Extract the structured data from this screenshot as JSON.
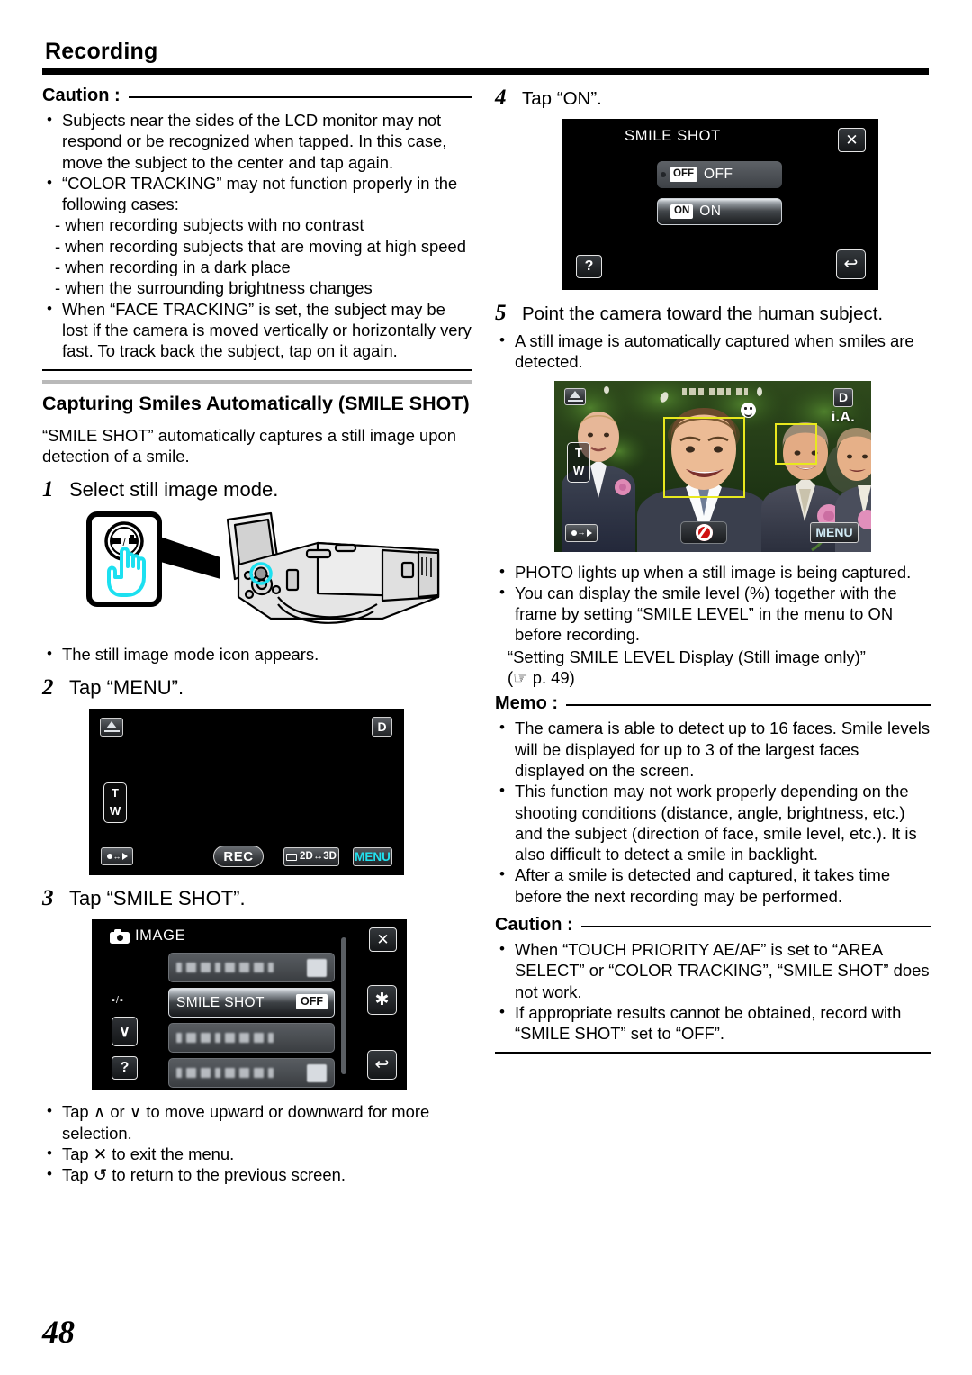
{
  "header": {
    "title": "Recording"
  },
  "page_number": "48",
  "left": {
    "caution1": {
      "label": "Caution :",
      "bullets": [
        "Subjects near the sides of the LCD monitor may not respond or be recognized when tapped. In this case, move the subject to the center and tap again.",
        "“COLOR TRACKING” may not function properly in the following cases:",
        "When “FACE TRACKING” is set, the subject may be lost if the camera is moved vertically or horizontally very fast. To track back the subject, tap on it again."
      ],
      "sublines": [
        "- when recording subjects with no contrast",
        "- when recording subjects that are moving at high speed",
        "- when recording in a dark place",
        "- when the surrounding brightness changes"
      ]
    },
    "section": {
      "heading": "Capturing Smiles Automatically (SMILE SHOT)",
      "intro": "“SMILE SHOT” automatically captures a still image upon detection of a smile."
    },
    "step1": {
      "num": "1",
      "text": "Select still image mode.",
      "note": "The still image mode icon appears."
    },
    "step2": {
      "num": "2",
      "text": "Tap “MENU”."
    },
    "step3": {
      "num": "3",
      "text": "Tap “SMILE SHOT”.",
      "notes": [
        "Tap ∧ or ∨ to move upward or downward for more selection.",
        "Tap ✕ to exit the menu.",
        "Tap ↺ to return to the previous screen."
      ]
    },
    "lcd_rec": {
      "warning_icon": "triangle-warning-icon",
      "d_badge": "D",
      "zoom_t": "T",
      "zoom_w": "W",
      "play_icon": "record-play-toggle-icon",
      "rec_label": "REC",
      "mode_2d3d": "2D↔3D",
      "menu_label": "MENU"
    },
    "lcd_image": {
      "title": "IMAGE",
      "camera_icon": "still-camera-icon",
      "close_label": "✕",
      "gear_label": "✱",
      "back_label": "↩",
      "help_label": "?",
      "down_label": "∨",
      "mode_glyph": "▪/▪",
      "selected_row_label": "SMILE SHOT",
      "selected_row_value": "OFF"
    }
  },
  "right": {
    "step4": {
      "num": "4",
      "text": "Tap “ON”."
    },
    "lcd_smile": {
      "title": "SMILE SHOT",
      "close_label": "✕",
      "help_label": "?",
      "back_label": "↩",
      "options": [
        {
          "badge": "OFF",
          "label": "OFF",
          "selected": false
        },
        {
          "badge": "ON",
          "label": "ON",
          "selected": true
        }
      ]
    },
    "step5": {
      "num": "5",
      "text": "Point the camera toward the human subject.",
      "note": "A still image is automatically captured when smiles are detected."
    },
    "lcd_photo": {
      "warning_icon": "triangle-warning-icon",
      "d_badge": "D",
      "ia_badge": "i.A.",
      "zoom_t": "T",
      "zoom_w": "W",
      "play_icon": "record-play-toggle-icon",
      "shutter_icon": "shutter-aperture-icon",
      "menu_label": "MENU",
      "smile_icon": "smile-face-icon"
    },
    "photo_notes": [
      "PHOTO lights up when a still image is being captured.",
      "You can display the smile level (%) together with the frame by setting “SMILE LEVEL” in the menu to ON before recording."
    ],
    "xref_title": "“Setting SMILE LEVEL Display (Still image only)”",
    "xref_page": "(☞ p. 49)",
    "memo": {
      "label": "Memo :",
      "bullets": [
        "The camera is able to detect up to 16 faces. Smile levels will be displayed for up to 3 of the largest faces displayed on the screen.",
        "This function may not work properly depending on the shooting conditions (distance, angle, brightness, etc.) and the subject (direction of face, smile level, etc.). It is also difficult to detect a smile in backlight.",
        "After a smile is detected and captured, it takes time before the next recording may be performed."
      ]
    },
    "caution2": {
      "label": "Caution :",
      "bullets": [
        "When “TOUCH PRIORITY AE/AF” is set to “AREA SELECT” or “COLOR TRACKING”, “SMILE SHOT” does not work.",
        "If appropriate results cannot be obtained, record with “SMILE SHOT” set to “OFF”."
      ]
    }
  }
}
